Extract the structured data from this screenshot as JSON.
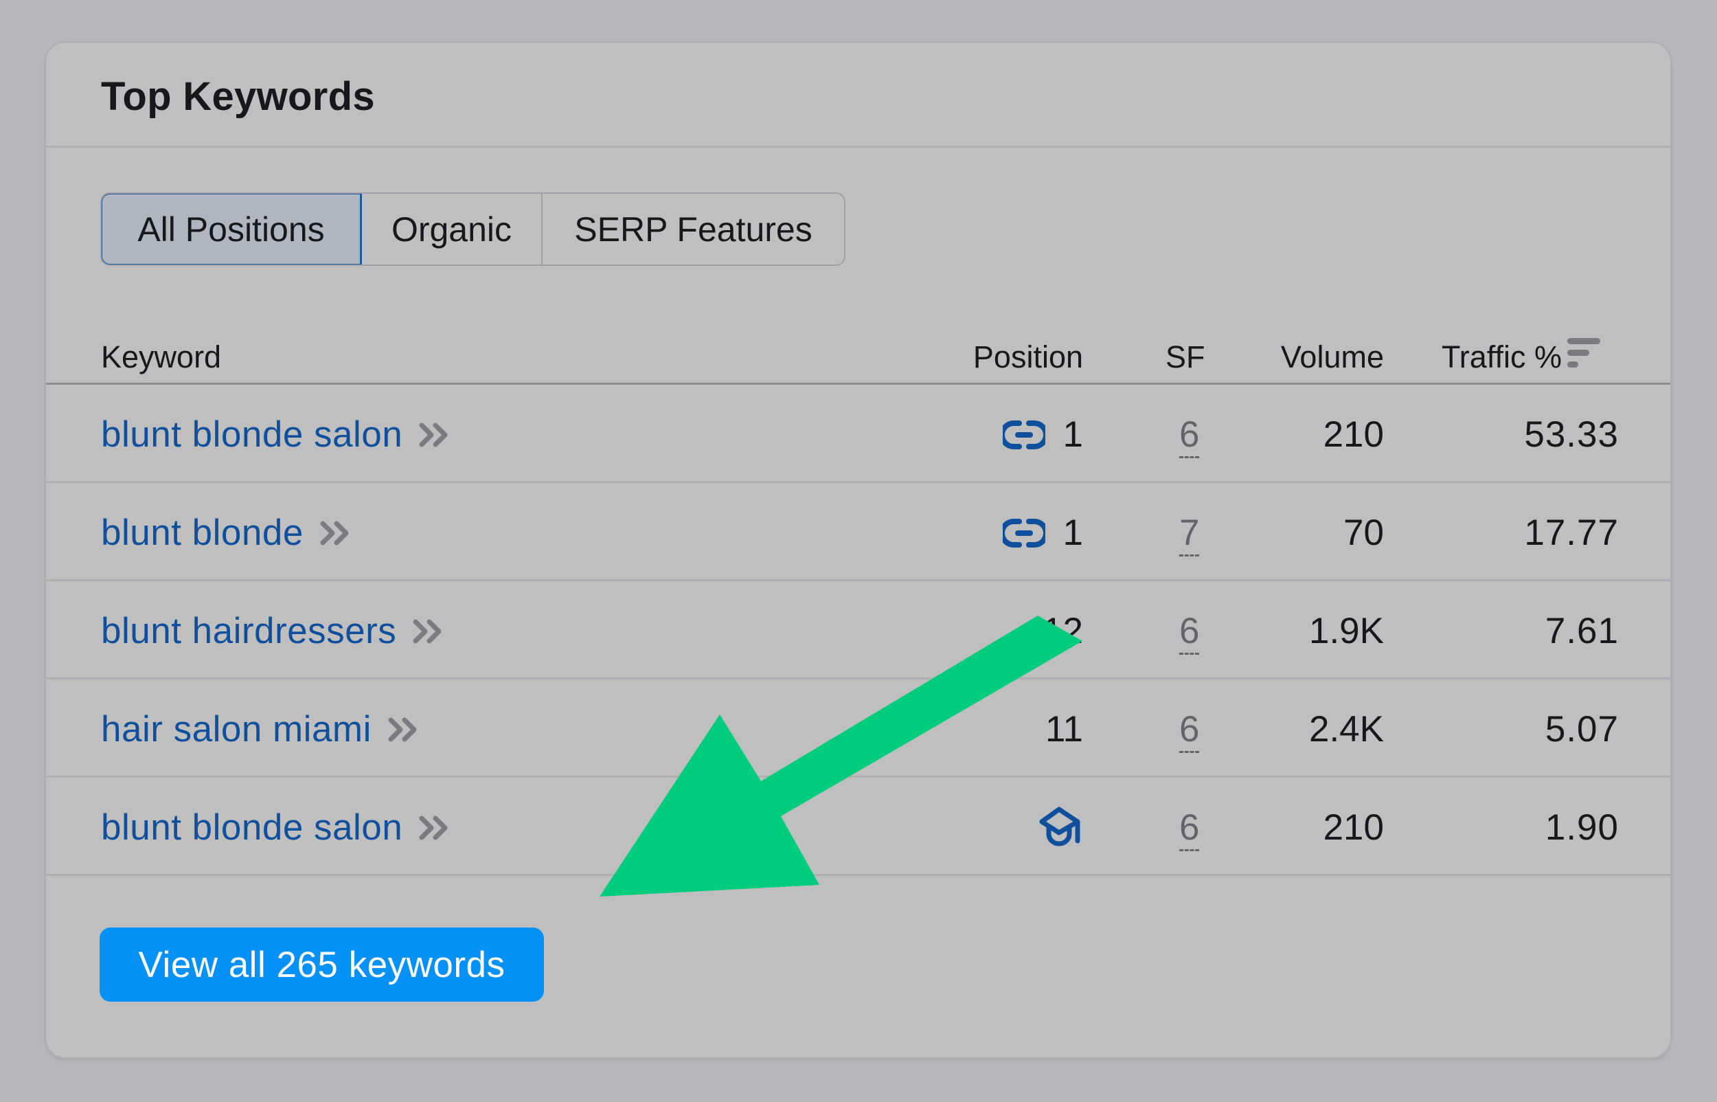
{
  "card": {
    "title": "Top Keywords"
  },
  "tabs": [
    {
      "label": "All Positions",
      "active": true
    },
    {
      "label": "Organic",
      "active": false
    },
    {
      "label": "SERP Features",
      "active": false
    }
  ],
  "table": {
    "columns": {
      "keyword": "Keyword",
      "position": "Position",
      "sf": "SF",
      "volume": "Volume",
      "traffic": "Traffic %"
    },
    "sort_icon": "sort-descending-icon",
    "rows": [
      {
        "keyword": "blunt blonde salon",
        "position_icon": "link-icon",
        "position": "1",
        "sf": "6",
        "volume": "210",
        "traffic": "53.33"
      },
      {
        "keyword": "blunt blonde",
        "position_icon": "link-icon",
        "position": "1",
        "sf": "7",
        "volume": "70",
        "traffic": "17.77"
      },
      {
        "keyword": "blunt hairdressers",
        "position_icon": "",
        "position": "12",
        "sf": "6",
        "volume": "1.9K",
        "traffic": "7.61"
      },
      {
        "keyword": "hair salon miami",
        "position_icon": "",
        "position": "11",
        "sf": "6",
        "volume": "2.4K",
        "traffic": "5.07"
      },
      {
        "keyword": "blunt blonde salon",
        "position_icon": "graduation-cap-icon",
        "position": "",
        "sf": "6",
        "volume": "210",
        "traffic": "1.90"
      }
    ]
  },
  "view_all_button": {
    "label": "View all 265 keywords"
  },
  "colors": {
    "link": "#0f4f9c",
    "primary_button": "#0591f7",
    "annotation_arrow": "#00cc7e",
    "active_tab_border": "#1b5aa0"
  }
}
